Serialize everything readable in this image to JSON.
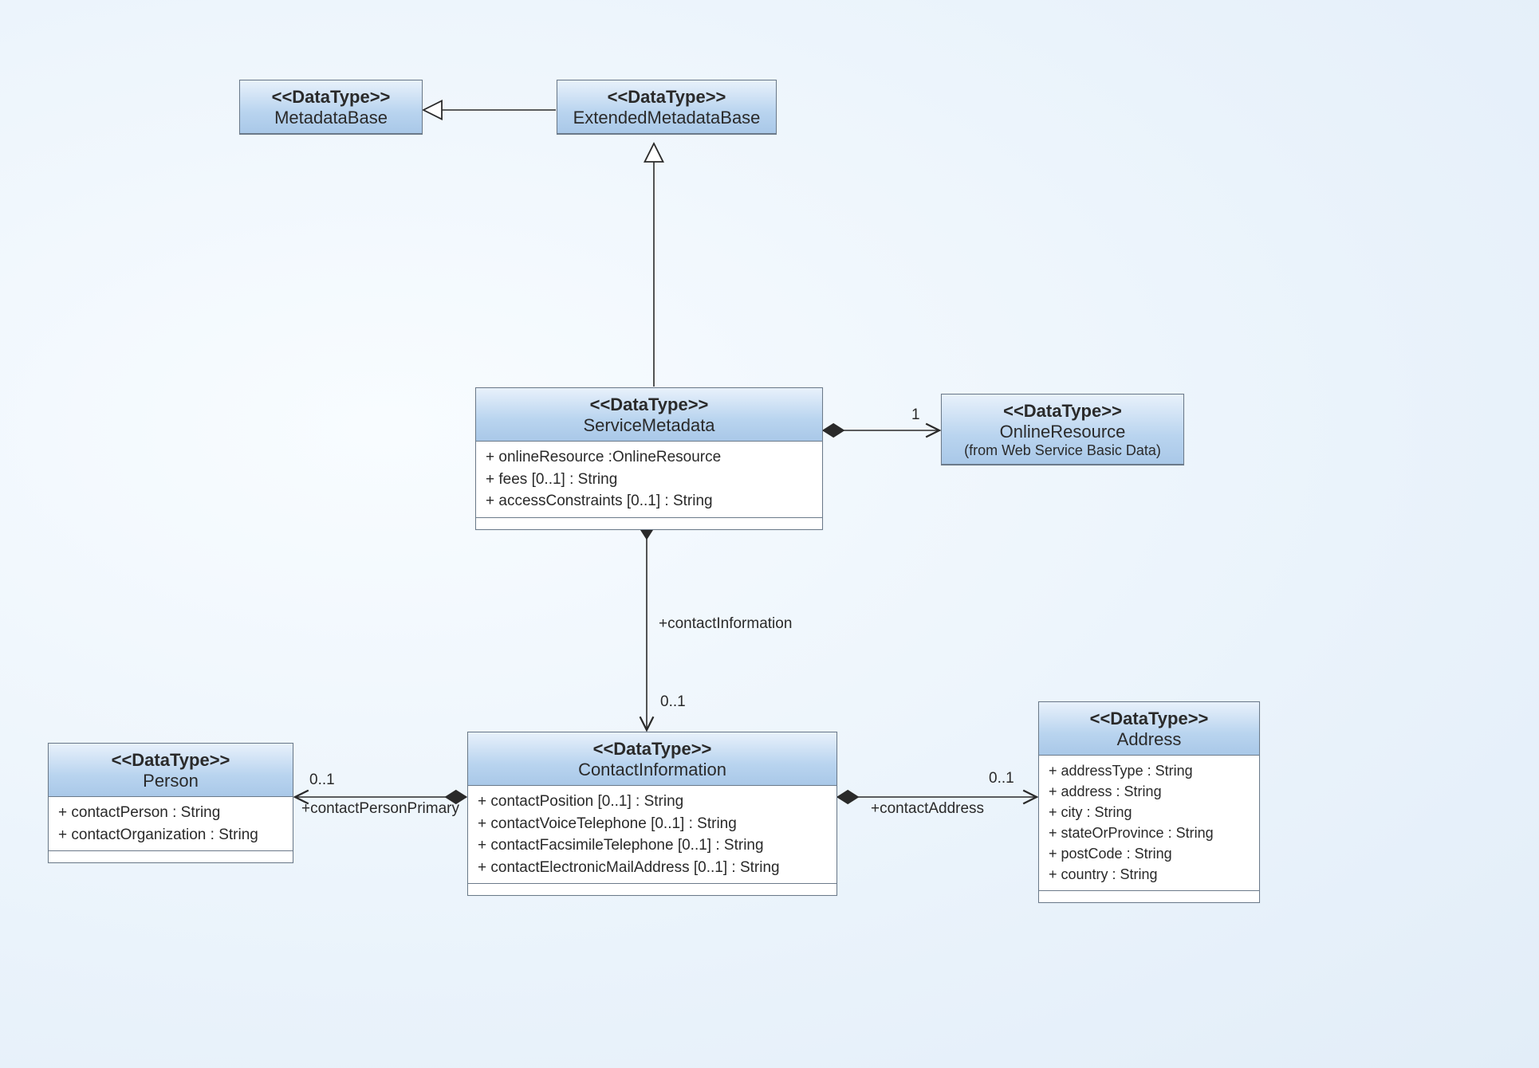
{
  "stereotype": "<<DataType>>",
  "classes": {
    "metadataBase": {
      "name": "MetadataBase"
    },
    "extendedMetadataBase": {
      "name": "ExtendedMetadataBase"
    },
    "serviceMetadata": {
      "name": "ServiceMetadata",
      "attrs": [
        "+ onlineResource :OnlineResource",
        "+ fees [0..1] : String",
        "+ accessConstraints [0..1] : String"
      ]
    },
    "onlineResource": {
      "name": "OnlineResource",
      "sub": "(from Web Service Basic Data)"
    },
    "contactInformation": {
      "name": "ContactInformation",
      "attrs": [
        "+ contactPosition [0..1] : String",
        "+ contactVoiceTelephone [0..1] : String",
        "+ contactFacsimileTelephone [0..1] : String",
        "+ contactElectronicMailAddress [0..1] : String"
      ]
    },
    "person": {
      "name": "Person",
      "attrs": [
        "+ contactPerson : String",
        "+ contactOrganization : String"
      ]
    },
    "address": {
      "name": "Address",
      "attrs": [
        "+ addressType : String",
        "+ address : String",
        "+ city : String",
        "+ stateOrProvince : String",
        "+ postCode : String",
        "+ country : String"
      ]
    }
  },
  "edges": {
    "contactInformationRole": "+contactInformation",
    "contactInformationMult": "0..1",
    "onlineResourceMult": "1",
    "contactPersonPrimaryRole": "+contactPersonPrimary",
    "contactPersonPrimaryMult": "0..1",
    "contactAddressRole": "+contactAddress",
    "contactAddressMult": "0..1"
  }
}
